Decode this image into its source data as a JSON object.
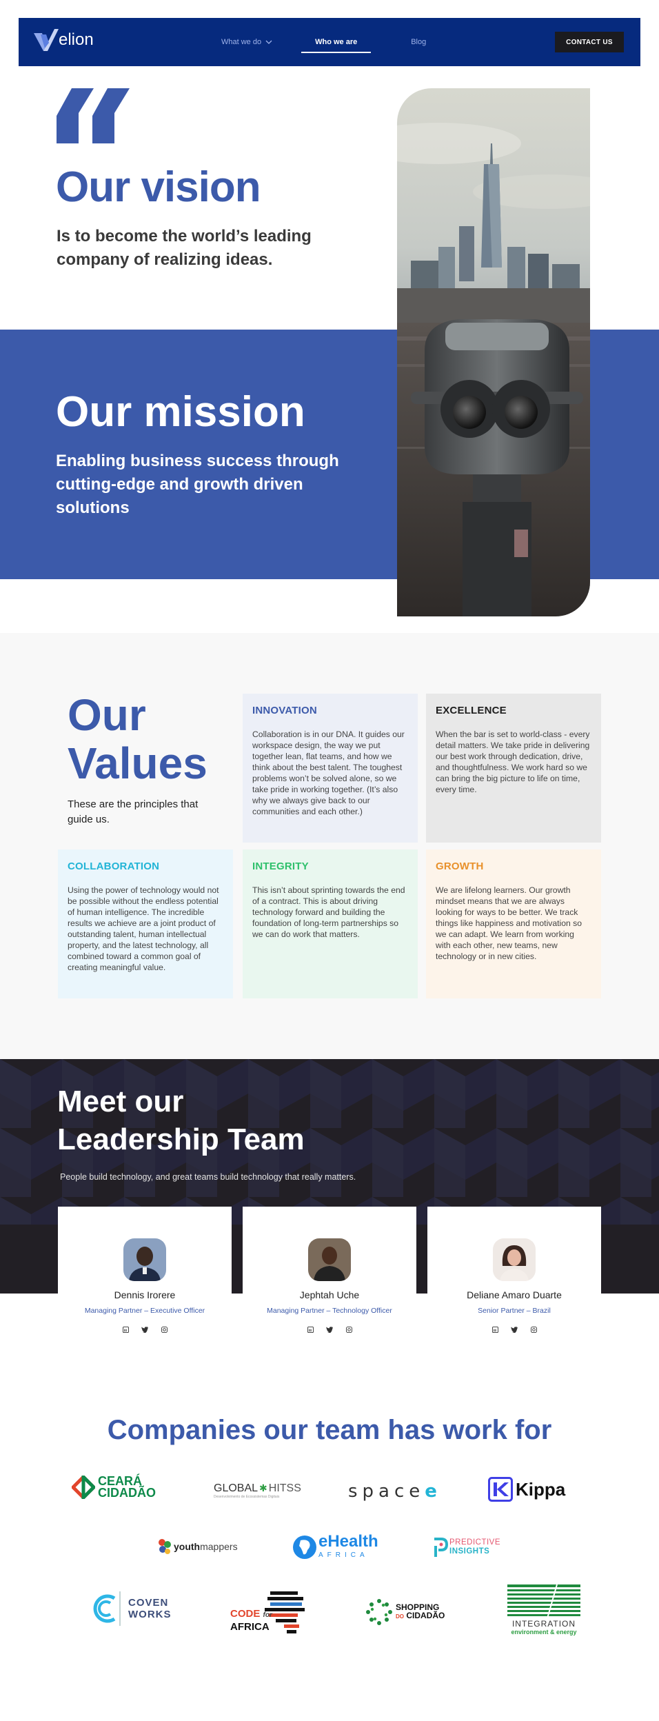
{
  "nav": {
    "logo_text": "elion",
    "links": [
      "What we do",
      "Who we are",
      "Blog"
    ],
    "cta": "CONTACT US"
  },
  "vision": {
    "title": "Our vision",
    "text": "Is to become the world’s leading company of realizing ideas."
  },
  "mission": {
    "title": "Our mission",
    "text": "Enabling business success through cutting-edge and growth driven solutions"
  },
  "values": {
    "title_line1": "Our",
    "title_line2": "Values",
    "subtitle": "These are the principles that guide us.",
    "cards": [
      {
        "title": "INNOVATION",
        "text": "Collaboration is in our DNA. It guides our workspace design, the way we put together lean, flat teams, and how we think about the best talent. The toughest problems won’t be solved alone, so we take pride in working together. (It’s also why we always give back to our communities and each other.)",
        "color": "#3c5aaa",
        "bg": "#eceff7"
      },
      {
        "title": "EXCELLENCE",
        "text": "When the bar is set to world-class - every detail matters. We take pride in delivering our best work through dedication, drive, and thoughtfulness. We work hard so we can bring the big picture to life on time, every time.",
        "color": "#1e1e1e",
        "bg": "#e8e8e8"
      },
      {
        "title": "COLLABORATION",
        "text": "Using the power of technology would not be possible without the endless potential of human intelligence. The incredible results we achieve are a joint product of outstanding talent, human intellectual property, and the latest technology, all combined toward a common goal of creating meaningful value.",
        "color": "#22b4d6",
        "bg": "#eaf6fc"
      },
      {
        "title": "INTEGRITY",
        "text": "This isn’t about sprinting towards the end of a contract. This is about driving technology forward and building the foundation of long-term partnerships so we can do work that matters.",
        "color": "#2ec06b",
        "bg": "#e9f7ef"
      },
      {
        "title": "GROWTH",
        "text": "We are lifelong learners. Our growth mindset means that we are always looking for ways to be better. We track things like happiness and motivation so we can adapt. We learn from working with each other, new teams, new technology or in new cities.",
        "color": "#e8912c",
        "bg": "#fdf4ea"
      }
    ]
  },
  "leadership": {
    "title_line1": "Meet our",
    "title_line2": "Leadership Team",
    "subtitle": "People build technology, and great teams build technology that really matters.",
    "members": [
      {
        "name": "Dennis Irorere",
        "role": "Managing Partner – Executive Officer"
      },
      {
        "name": "Jephtah Uche",
        "role": "Managing Partner – Technology Officer"
      },
      {
        "name": "Deliane Amaro Duarte",
        "role": "Senior Partner – Brazil"
      }
    ]
  },
  "companies": {
    "title": "Companies our team has work for",
    "logos": [
      {
        "line1": "CEARÁ",
        "line2": "CIDADÃO"
      },
      {
        "line1": "GLOBAL",
        "line2": "HITSS",
        "tagline": "Desenvolvimento de Ecossistemas Digitais"
      },
      {
        "line1": "space"
      },
      {
        "line1": "Kippa"
      },
      {
        "line1": "youth",
        "line2": "mappers"
      },
      {
        "line1": "eHealth",
        "line2": "AFRICA"
      },
      {
        "line1": "PREDICTIVE",
        "line2": "INSIGHTS"
      },
      {
        "line1": "COVEN",
        "line2": "WORKS"
      },
      {
        "line1": "CODE",
        "line2": "for",
        "line3": "AFRICA"
      },
      {
        "line1": "SHOPPING",
        "line2": "DO",
        "line3": "CIDADÃO"
      },
      {
        "line1": "INTEGRATION",
        "line2": "environment & energy"
      }
    ]
  }
}
